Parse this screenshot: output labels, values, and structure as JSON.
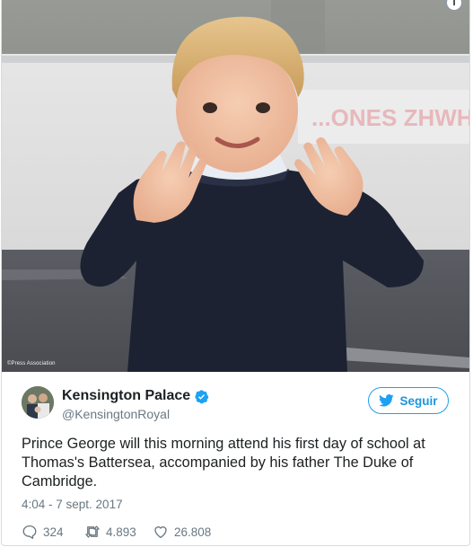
{
  "media": {
    "info_glyph": "i",
    "photo_credit": "©Press Association",
    "background_sign_text": "...ONES ZHWH'S"
  },
  "author": {
    "name": "Kensington Palace",
    "handle": "@KensingtonRoyal",
    "verified": true,
    "verified_icon": "verified-badge-icon"
  },
  "follow": {
    "label": "Seguir",
    "icon": "twitter-bird-icon"
  },
  "tweet": {
    "text": "Prince George will this morning attend his first day of school at Thomas's Battersea, accompanied by his father The Duke of Cambridge.",
    "timestamp": "4:04 - 7 sept. 2017"
  },
  "actions": {
    "reply_count": "324",
    "retweet_count": "4.893",
    "like_count": "26.808"
  },
  "colors": {
    "accent": "#1da1f2",
    "text": "#1c2022",
    "muted": "#697882"
  }
}
